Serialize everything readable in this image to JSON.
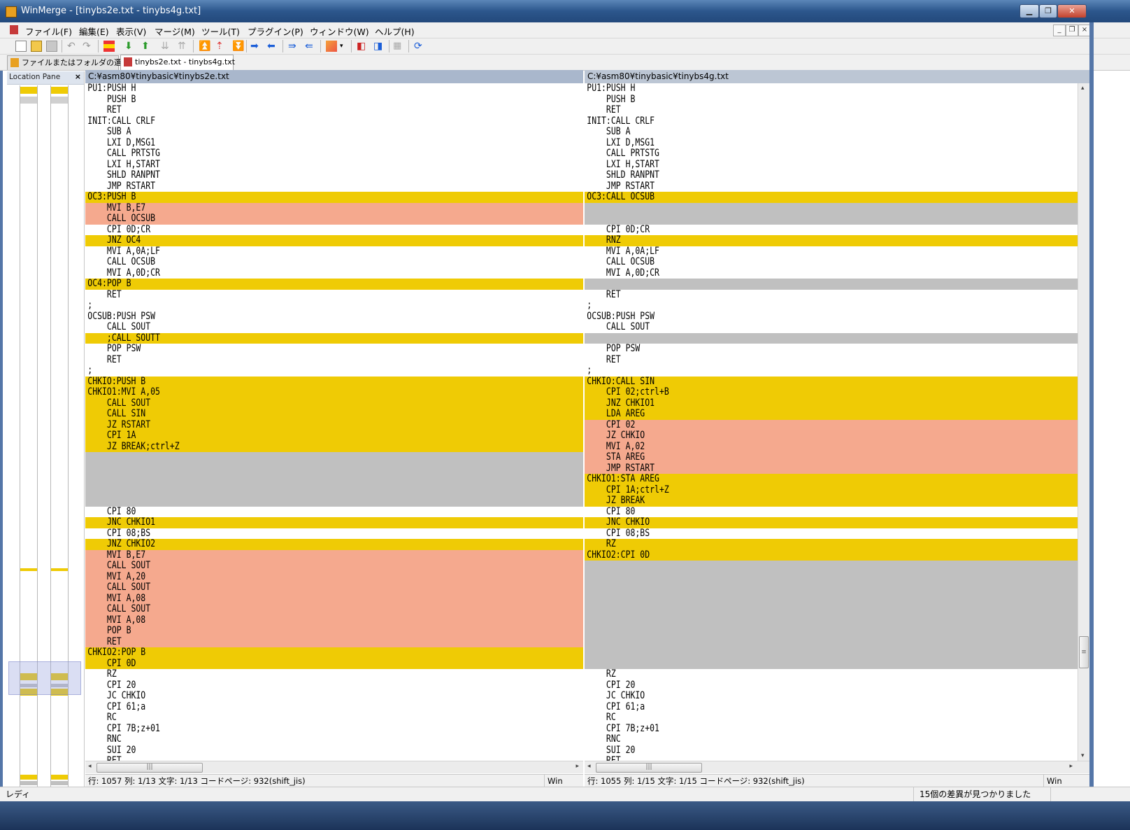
{
  "window": {
    "title": "WinMerge - [tinybs2e.txt - tinybs4g.txt]"
  },
  "menu": [
    "ファイル(F)",
    "編集(E)",
    "表示(V)",
    "マージ(M)",
    "ツール(T)",
    "プラグイン(P)",
    "ウィンドウ(W)",
    "ヘルプ(H)"
  ],
  "tabs": [
    {
      "label": "ファイルまたはフォルダの選択..."
    },
    {
      "label": "tinybs2e.txt - tinybs4g.txt",
      "active": true
    }
  ],
  "location_pane": {
    "title": "Location Pane",
    "close": "×"
  },
  "left": {
    "path": "C:¥asm80¥tinybasic¥tinybs2e.txt",
    "status": "行: 1057  列: 1/13  文字: 1/13  コードページ: 932(shift_jis)",
    "eol": "Win",
    "lines": [
      {
        "t": "PU1:PUSH H",
        "s": ""
      },
      {
        "t": "    PUSH B",
        "s": ""
      },
      {
        "t": "    RET",
        "s": ""
      },
      {
        "t": "INIT:CALL CRLF",
        "s": ""
      },
      {
        "t": "    SUB A",
        "s": ""
      },
      {
        "t": "    LXI D,MSG1",
        "s": ""
      },
      {
        "t": "    CALL PRTSTG",
        "s": ""
      },
      {
        "t": "    LXI H,START",
        "s": ""
      },
      {
        "t": "    SHLD RANPNT",
        "s": ""
      },
      {
        "t": "    JMP RSTART",
        "s": ""
      },
      {
        "t": "OC3:PUSH B",
        "s": "diff"
      },
      {
        "t": "    MVI B,E7",
        "s": "edit"
      },
      {
        "t": "    CALL OCSUB",
        "s": "edit"
      },
      {
        "t": "    CPI 0D;CR",
        "s": ""
      },
      {
        "t": "    JNZ OC4",
        "s": "diff"
      },
      {
        "t": "    MVI A,0A;LF",
        "s": ""
      },
      {
        "t": "    CALL OCSUB",
        "s": ""
      },
      {
        "t": "    MVI A,0D;CR",
        "s": ""
      },
      {
        "t": "OC4:POP B",
        "s": "diff"
      },
      {
        "t": "    RET",
        "s": ""
      },
      {
        "t": ";",
        "s": ""
      },
      {
        "t": "OCSUB:PUSH PSW",
        "s": ""
      },
      {
        "t": "    CALL SOUT",
        "s": ""
      },
      {
        "t": "    ;CALL SOUTT",
        "s": "diff"
      },
      {
        "t": "    POP PSW",
        "s": ""
      },
      {
        "t": "    RET",
        "s": ""
      },
      {
        "t": ";",
        "s": ""
      },
      {
        "t": "CHKIO:PUSH B",
        "s": "diff"
      },
      {
        "t": "CHKIO1:MVI A,05",
        "s": "diff"
      },
      {
        "t": "    CALL SOUT",
        "s": "diff"
      },
      {
        "t": "    CALL SIN",
        "s": "diff"
      },
      {
        "t": "    JZ RSTART",
        "s": "diff"
      },
      {
        "t": "    CPI 1A",
        "s": "diff"
      },
      {
        "t": "    JZ BREAK;ctrl+Z",
        "s": "diff"
      },
      {
        "t": "",
        "s": "ghost"
      },
      {
        "t": "",
        "s": "ghost"
      },
      {
        "t": "",
        "s": "ghost"
      },
      {
        "t": "",
        "s": "ghost"
      },
      {
        "t": "",
        "s": "ghost"
      },
      {
        "t": "    CPI 80",
        "s": ""
      },
      {
        "t": "    JNC CHKIO1",
        "s": "diff"
      },
      {
        "t": "    CPI 08;BS",
        "s": ""
      },
      {
        "t": "    JNZ CHKIO2",
        "s": "diff"
      },
      {
        "t": "    MVI B,E7",
        "s": "edit"
      },
      {
        "t": "    CALL SOUT",
        "s": "edit"
      },
      {
        "t": "    MVI A,20",
        "s": "edit"
      },
      {
        "t": "    CALL SOUT",
        "s": "edit"
      },
      {
        "t": "    MVI A,08",
        "s": "edit"
      },
      {
        "t": "    CALL SOUT",
        "s": "edit"
      },
      {
        "t": "    MVI A,08",
        "s": "edit"
      },
      {
        "t": "    POP B",
        "s": "edit"
      },
      {
        "t": "    RET",
        "s": "edit"
      },
      {
        "t": "CHKIO2:POP B",
        "s": "diff"
      },
      {
        "t": "    CPI 0D",
        "s": "diff"
      },
      {
        "t": "    RZ",
        "s": ""
      },
      {
        "t": "    CPI 20",
        "s": ""
      },
      {
        "t": "    JC CHKIO",
        "s": ""
      },
      {
        "t": "    CPI 61;a",
        "s": ""
      },
      {
        "t": "    RC",
        "s": ""
      },
      {
        "t": "    CPI 7B;z+01",
        "s": ""
      },
      {
        "t": "    RNC",
        "s": ""
      },
      {
        "t": "    SUI 20",
        "s": ""
      },
      {
        "t": "    RET",
        "s": ""
      }
    ]
  },
  "right": {
    "path": "C:¥asm80¥tinybasic¥tinybs4g.txt",
    "status": "行: 1055  列: 1/15  文字: 1/15  コードページ: 932(shift_jis)",
    "eol": "Win",
    "lines": [
      {
        "t": "PU1:PUSH H",
        "s": ""
      },
      {
        "t": "    PUSH B",
        "s": ""
      },
      {
        "t": "    RET",
        "s": ""
      },
      {
        "t": "INIT:CALL CRLF",
        "s": ""
      },
      {
        "t": "    SUB A",
        "s": ""
      },
      {
        "t": "    LXI D,MSG1",
        "s": ""
      },
      {
        "t": "    CALL PRTSTG",
        "s": ""
      },
      {
        "t": "    LXI H,START",
        "s": ""
      },
      {
        "t": "    SHLD RANPNT",
        "s": ""
      },
      {
        "t": "    JMP RSTART",
        "s": ""
      },
      {
        "t": "OC3:CALL OCSUB",
        "s": "diff"
      },
      {
        "t": "",
        "s": "ghost"
      },
      {
        "t": "",
        "s": "ghost"
      },
      {
        "t": "    CPI 0D;CR",
        "s": ""
      },
      {
        "t": "    RNZ",
        "s": "diff"
      },
      {
        "t": "    MVI A,0A;LF",
        "s": ""
      },
      {
        "t": "    CALL OCSUB",
        "s": ""
      },
      {
        "t": "    MVI A,0D;CR",
        "s": ""
      },
      {
        "t": "",
        "s": "ghost"
      },
      {
        "t": "    RET",
        "s": ""
      },
      {
        "t": ";",
        "s": ""
      },
      {
        "t": "OCSUB:PUSH PSW",
        "s": ""
      },
      {
        "t": "    CALL SOUT",
        "s": ""
      },
      {
        "t": "",
        "s": "ghost"
      },
      {
        "t": "    POP PSW",
        "s": ""
      },
      {
        "t": "    RET",
        "s": ""
      },
      {
        "t": ";",
        "s": ""
      },
      {
        "t": "CHKIO:CALL SIN",
        "s": "diff"
      },
      {
        "t": "    CPI 02;ctrl+B",
        "s": "diff"
      },
      {
        "t": "    JNZ CHKIO1",
        "s": "diff"
      },
      {
        "t": "    LDA AREG",
        "s": "diff"
      },
      {
        "t": "    CPI 02",
        "s": "edit"
      },
      {
        "t": "    JZ CHKIO",
        "s": "edit"
      },
      {
        "t": "    MVI A,02",
        "s": "edit"
      },
      {
        "t": "    STA AREG",
        "s": "edit"
      },
      {
        "t": "    JMP RSTART",
        "s": "edit"
      },
      {
        "t": "CHKIO1:STA AREG",
        "s": "diff"
      },
      {
        "t": "    CPI 1A;ctrl+Z",
        "s": "diff"
      },
      {
        "t": "    JZ BREAK",
        "s": "diff"
      },
      {
        "t": "    CPI 80",
        "s": ""
      },
      {
        "t": "    JNC CHKIO",
        "s": "diff"
      },
      {
        "t": "    CPI 08;BS",
        "s": ""
      },
      {
        "t": "    RZ",
        "s": "diff"
      },
      {
        "t": "CHKIO2:CPI 0D",
        "s": "diff"
      },
      {
        "t": "",
        "s": "ghost"
      },
      {
        "t": "",
        "s": "ghost"
      },
      {
        "t": "",
        "s": "ghost"
      },
      {
        "t": "",
        "s": "ghost"
      },
      {
        "t": "",
        "s": "ghost"
      },
      {
        "t": "",
        "s": "ghost"
      },
      {
        "t": "",
        "s": "ghost"
      },
      {
        "t": "",
        "s": "ghost"
      },
      {
        "t": "",
        "s": "ghost"
      },
      {
        "t": "",
        "s": "ghost"
      },
      {
        "t": "    RZ",
        "s": ""
      },
      {
        "t": "    CPI 20",
        "s": ""
      },
      {
        "t": "    JC CHKIO",
        "s": ""
      },
      {
        "t": "    CPI 61;a",
        "s": ""
      },
      {
        "t": "    RC",
        "s": ""
      },
      {
        "t": "    CPI 7B;z+01",
        "s": ""
      },
      {
        "t": "    RNC",
        "s": ""
      },
      {
        "t": "    SUI 20",
        "s": ""
      },
      {
        "t": "    RET",
        "s": ""
      }
    ]
  },
  "statusbar": {
    "left": "レディ",
    "right": "15個の差異が見つかりました"
  },
  "colors": {
    "diff": "#efcb05",
    "ghost": "#c0c0c0",
    "edit": "#f5a98e",
    "header": "#a9b7cc"
  }
}
